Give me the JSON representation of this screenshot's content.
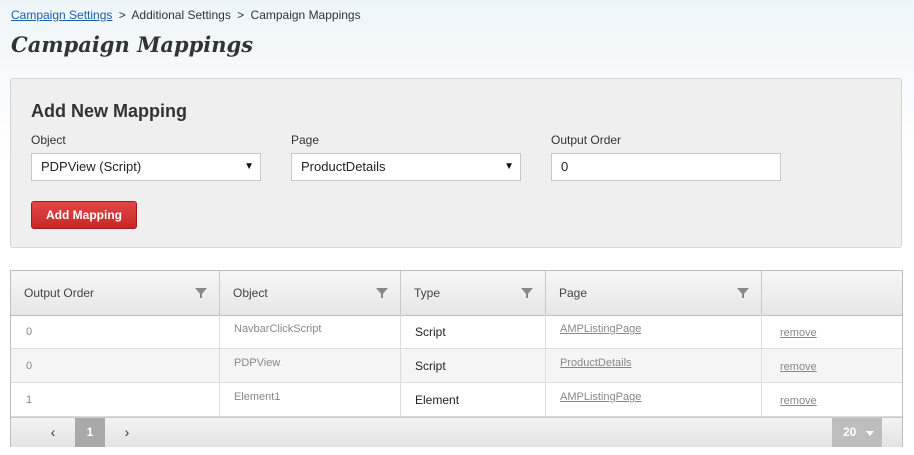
{
  "breadcrumb": {
    "link": "Campaign Settings",
    "sep1": ">",
    "item2": "Additional Settings",
    "sep2": ">",
    "item3": "Campaign Mappings"
  },
  "page_title": "Campaign Mappings",
  "form": {
    "heading": "Add New Mapping",
    "object_label": "Object",
    "object_value": "PDPView (Script)",
    "page_label": "Page",
    "page_value": "ProductDetails",
    "order_label": "Output Order",
    "order_value": "0",
    "add_button": "Add Mapping"
  },
  "table": {
    "columns": [
      "Output Order",
      "Object",
      "Type",
      "Page",
      ""
    ],
    "rows": [
      {
        "order": "0",
        "object": "NavbarClickScript",
        "type": "Script",
        "page": "AMPListingPage",
        "action": "remove"
      },
      {
        "order": "0",
        "object": "PDPView",
        "type": "Script",
        "page": "ProductDetails",
        "action": "remove"
      },
      {
        "order": "1",
        "object": "Element1",
        "type": "Element",
        "page": "AMPListingPage",
        "action": "remove"
      }
    ]
  },
  "pager": {
    "prev": "‹",
    "current_page": "1",
    "next": "›",
    "page_size": "20"
  },
  "colors": {
    "accent_red": "#d33a3a",
    "link_blue": "#1a5fa8"
  }
}
